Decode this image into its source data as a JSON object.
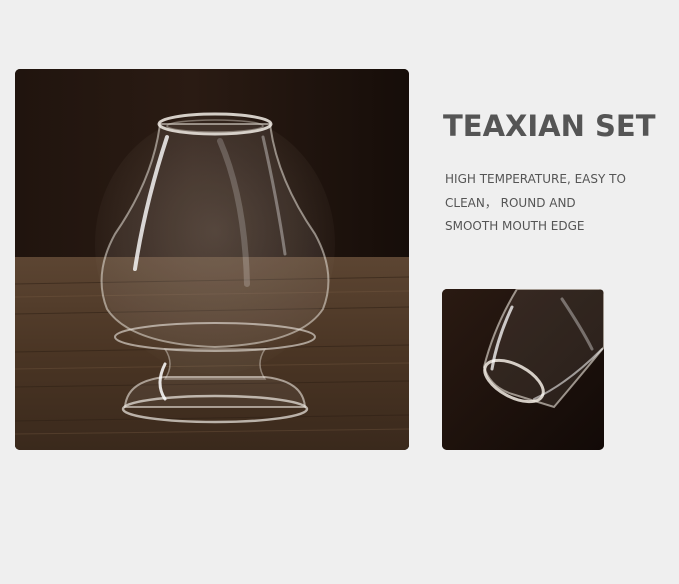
{
  "heading": {
    "title": "TEAXIAN SET"
  },
  "description": {
    "lines": [
      "HIGH TEMPERATURE, EASY TO",
      "CLEAN， ROUND AND",
      "SMOOTH MOUTH EDGE"
    ]
  },
  "colors": {
    "background": "#efefef",
    "text": "#555555",
    "photo_dark": "#1a100b",
    "wood": "#4a3524"
  },
  "images": {
    "main": "glass-whisk-holder-on-wooden-table-photo",
    "detail": "glass-rim-closeup-photo"
  }
}
